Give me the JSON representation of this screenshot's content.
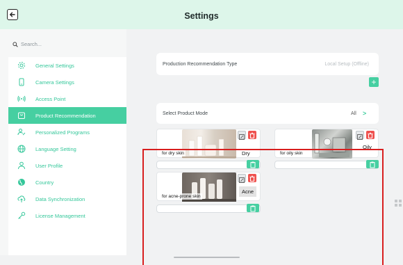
{
  "header": {
    "title": "Settings",
    "back_icon": "arrow-left-icon"
  },
  "search": {
    "placeholder": "Search..."
  },
  "sidebar": {
    "items": [
      {
        "label": "General Settings",
        "icon": "gear-icon"
      },
      {
        "label": "Camera Settings",
        "icon": "camera-icon"
      },
      {
        "label": "Access Point",
        "icon": "wifi-icon"
      },
      {
        "label": "Product Recommendation",
        "icon": "bag-icon",
        "active": true
      },
      {
        "label": "Personalized Programs",
        "icon": "user-edit-icon"
      },
      {
        "label": "Language Setting",
        "icon": "globe-icon"
      },
      {
        "label": "User Profile",
        "icon": "user-icon"
      },
      {
        "label": "Country",
        "icon": "globe-filled-icon"
      },
      {
        "label": "Data Synchronization",
        "icon": "cloud-sync-icon"
      },
      {
        "label": "License Management",
        "icon": "key-icon"
      }
    ]
  },
  "main": {
    "recommendation_type": {
      "label": "Production Recommendation Type",
      "value": "Local Setup (Offline)"
    },
    "product_mode": {
      "label": "Select Product Mode",
      "value": "All"
    },
    "products": [
      {
        "name": "Dry",
        "description": "for dry skin"
      },
      {
        "name": "Oily",
        "description": "for oily skin"
      },
      {
        "name": "Acne",
        "description": "for acne-prone skin"
      }
    ]
  },
  "colors": {
    "accent": "#46cfa1",
    "header_bg": "#ddf6ea",
    "delete": "#ef5350",
    "highlight_box": "#d81e1e"
  }
}
